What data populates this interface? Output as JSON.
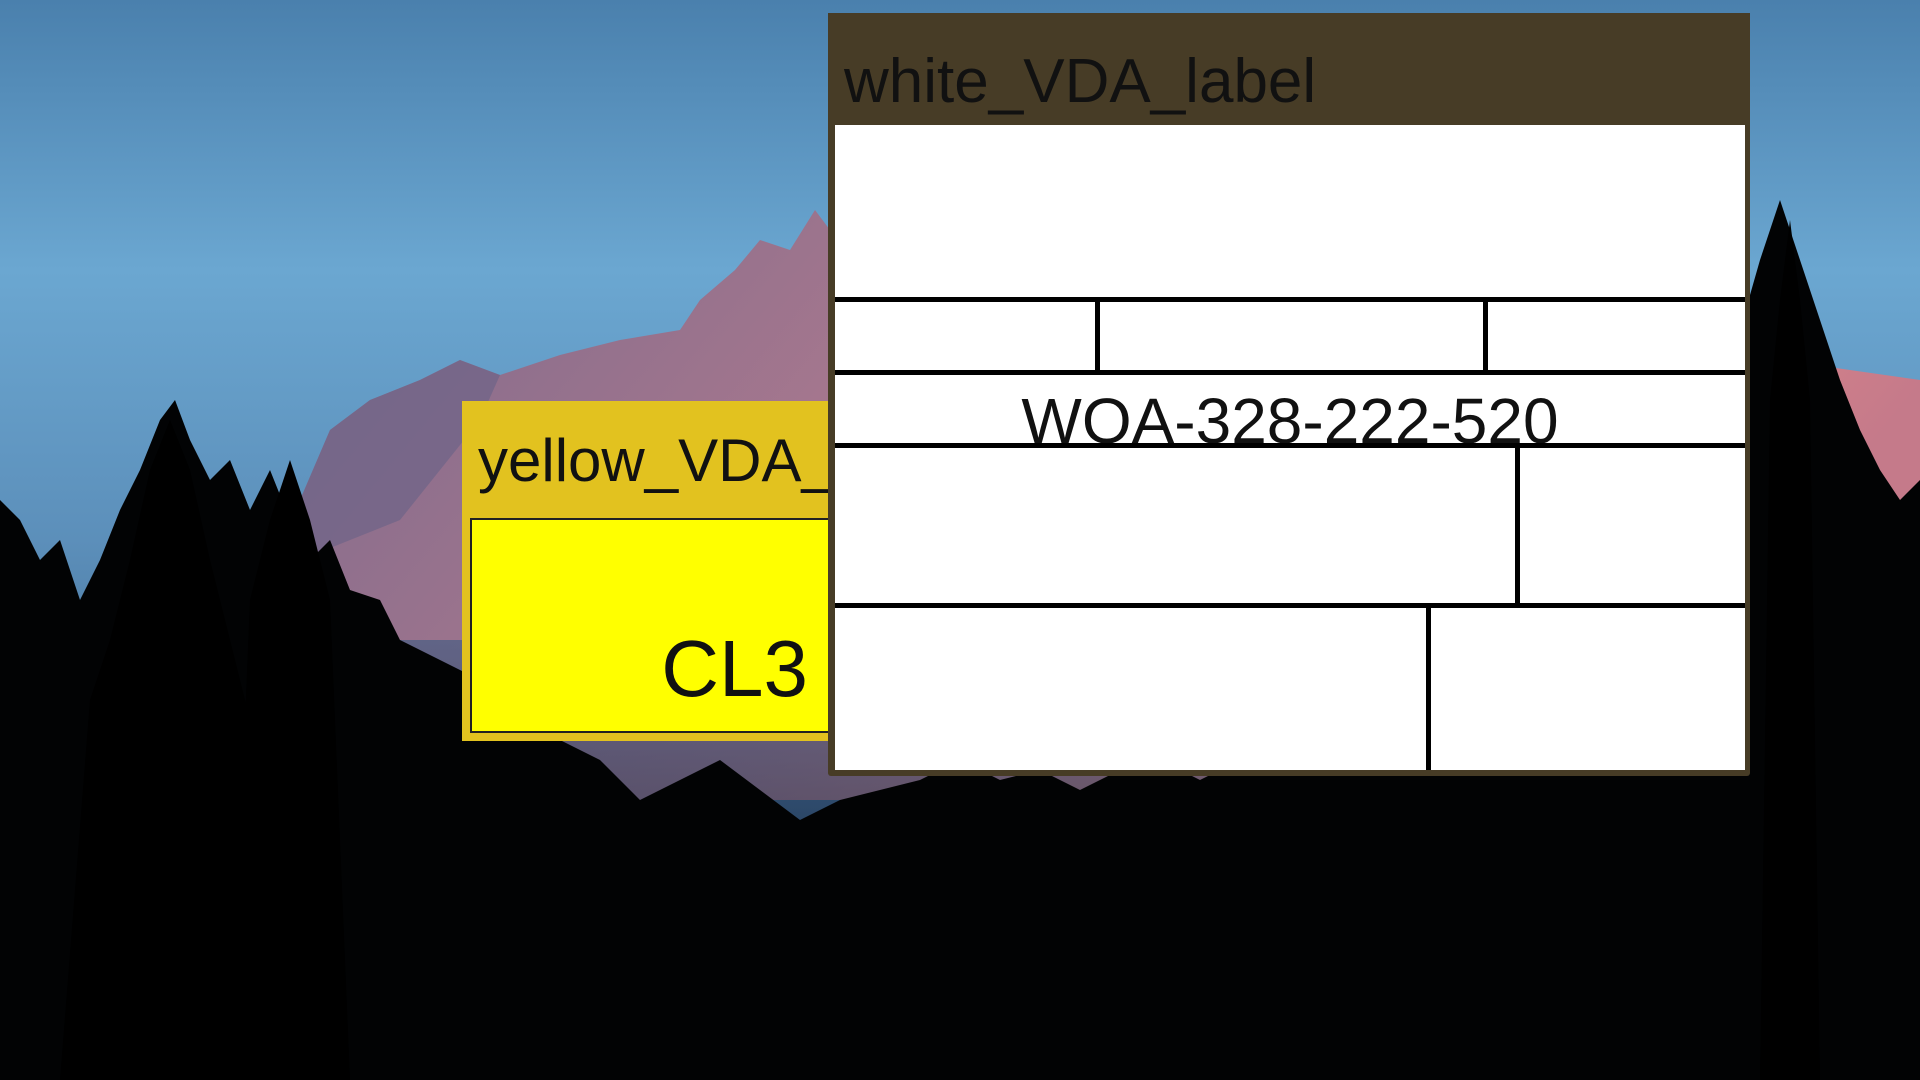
{
  "windows": {
    "yellow": {
      "title": "yellow_VDA_label",
      "code": "CL3",
      "colors": {
        "titlebar": "#e2c21f",
        "content": "#ffff00"
      }
    },
    "white": {
      "title": "white_VDA_label",
      "code": "WOA-328-222-520",
      "colors": {
        "titlebar": "#473c26",
        "content": "#ffffff"
      }
    }
  },
  "wallpaper": {
    "subject": "mountain-at-dusk-with-forest-silhouette",
    "colors": {
      "sky_top": "#4f86b3",
      "sky_mid": "#6aa6d0",
      "peak": "#e28a8a",
      "forest": "#000000"
    }
  }
}
